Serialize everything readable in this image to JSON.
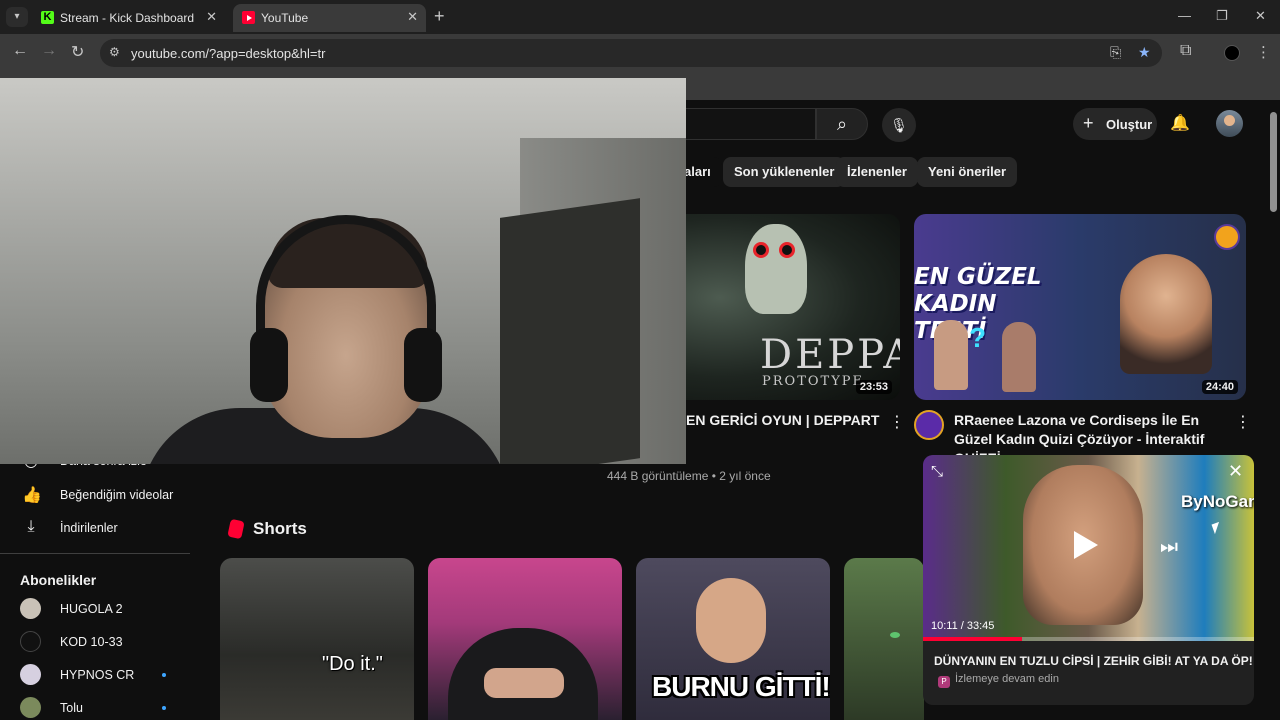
{
  "browser": {
    "tabs": [
      {
        "title": "Stream - Kick Dashboard",
        "icon": "kick-favicon",
        "favicon_glyph": "K",
        "active": false
      },
      {
        "title": "YouTube",
        "icon": "youtube-favicon",
        "active": true
      }
    ],
    "url": "youtube.com/?app=desktop&hl=tr"
  },
  "header": {
    "create_label": "Oluştur"
  },
  "chips": [
    "aları",
    "Son yüklenenler",
    "İzlenenler",
    "Yeni öneriler"
  ],
  "videos": [
    {
      "title": "EN GERİCİ OYUN | DEPPART",
      "duration": "23:53",
      "thumb_title": "DEPPART",
      "thumb_subtitle": "PROTOTYPE",
      "meta": "444 B görüntüleme • 2 yıl önce"
    },
    {
      "title": "RRaenee Lazona ve Cordiseps İle En Güzel Kadın Quizi Çözüyor - İnteraktif QUİZEİ",
      "duration": "24:40",
      "thumb_text": "EN GÜZEL KADIN TESTİ"
    }
  ],
  "sidebar": {
    "items": [
      {
        "label": "Daha sonra izle",
        "icon": "clock-icon"
      },
      {
        "label": "Beğendiğim videolar",
        "icon": "thumbs-up-icon"
      },
      {
        "label": "İndirilenler",
        "icon": "download-icon"
      }
    ],
    "subscriptions_heading": "Abonelikler",
    "subscriptions": [
      {
        "name": "HUGOLA 2",
        "new": false
      },
      {
        "name": "KOD 10-33",
        "new": false
      },
      {
        "name": "HYPNOS CR",
        "new": true
      },
      {
        "name": "Tolu",
        "new": true
      }
    ]
  },
  "shorts": {
    "heading": "Shorts",
    "captions": [
      "\"Do it.\"",
      "",
      "BURNU GİTTİ!",
      ""
    ]
  },
  "miniplayer": {
    "time": "10:11 / 33:45",
    "progress": 0.3,
    "title": "DÜNYANIN EN TUZLU CİPSİ | ZEHİR GİBİ! AT YA DA ÖP!",
    "subtitle": "İzlemeye devam edin",
    "subtitle_icon_letter": "P",
    "brand_overlay": "ByNoGame"
  },
  "colors": {
    "youtube_red": "#ff0033",
    "kick_green": "#53fc18",
    "link_blue": "#3ea6ff"
  }
}
